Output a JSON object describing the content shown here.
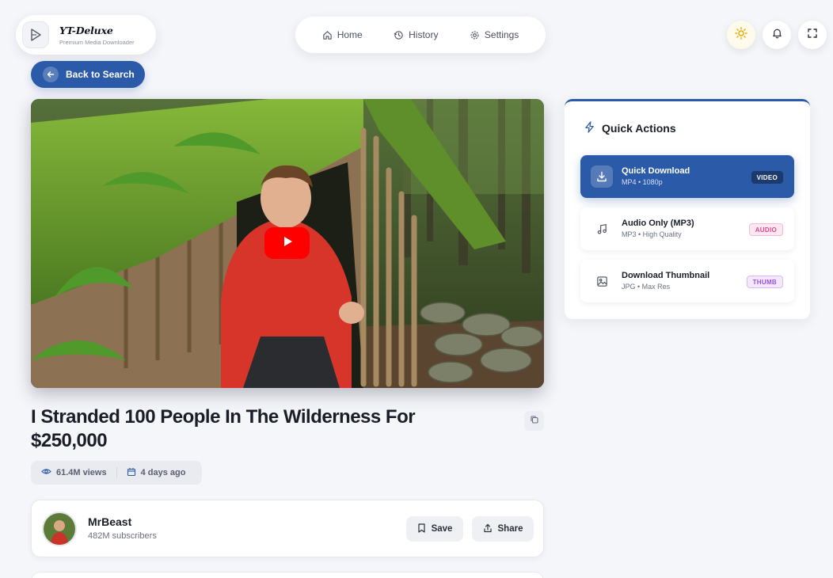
{
  "brand": {
    "name": "YT-Deluxe",
    "tagline": "Premium Media Downloader"
  },
  "nav": {
    "items": [
      {
        "label": "Home",
        "icon": "home-icon"
      },
      {
        "label": "History",
        "icon": "history-icon"
      },
      {
        "label": "Settings",
        "icon": "gear-icon"
      }
    ]
  },
  "header_actions": {
    "icons": [
      "sun-icon",
      "bell-icon",
      "fullscreen-icon"
    ]
  },
  "back_button": {
    "label": "Back to Search"
  },
  "video": {
    "title": "I Stranded 100 People In The Wilderness For $250,000",
    "views": "61.4M views",
    "published": "4 days ago"
  },
  "channel": {
    "name": "MrBeast",
    "subscribers": "482M subscribers",
    "save_label": "Save",
    "share_label": "Share"
  },
  "quick_actions": {
    "title": "Quick Actions",
    "items": [
      {
        "title": "Quick Download",
        "subtitle": "MP4 • 1080p",
        "tag": "VIDEO",
        "icon": "download-icon"
      },
      {
        "title": "Audio Only (MP3)",
        "subtitle": "MP3 • High Quality",
        "tag": "AUDIO",
        "icon": "music-note-icon"
      },
      {
        "title": "Download Thumbnail",
        "subtitle": "JPG • Max Res",
        "tag": "THUMB",
        "icon": "image-icon"
      }
    ]
  },
  "colors": {
    "accent": "#2b5aa8",
    "background": "#f5f6fa",
    "play_red": "#ff0000",
    "audio_tag": "#e0478a",
    "thumb_tag": "#9a4fe0"
  }
}
